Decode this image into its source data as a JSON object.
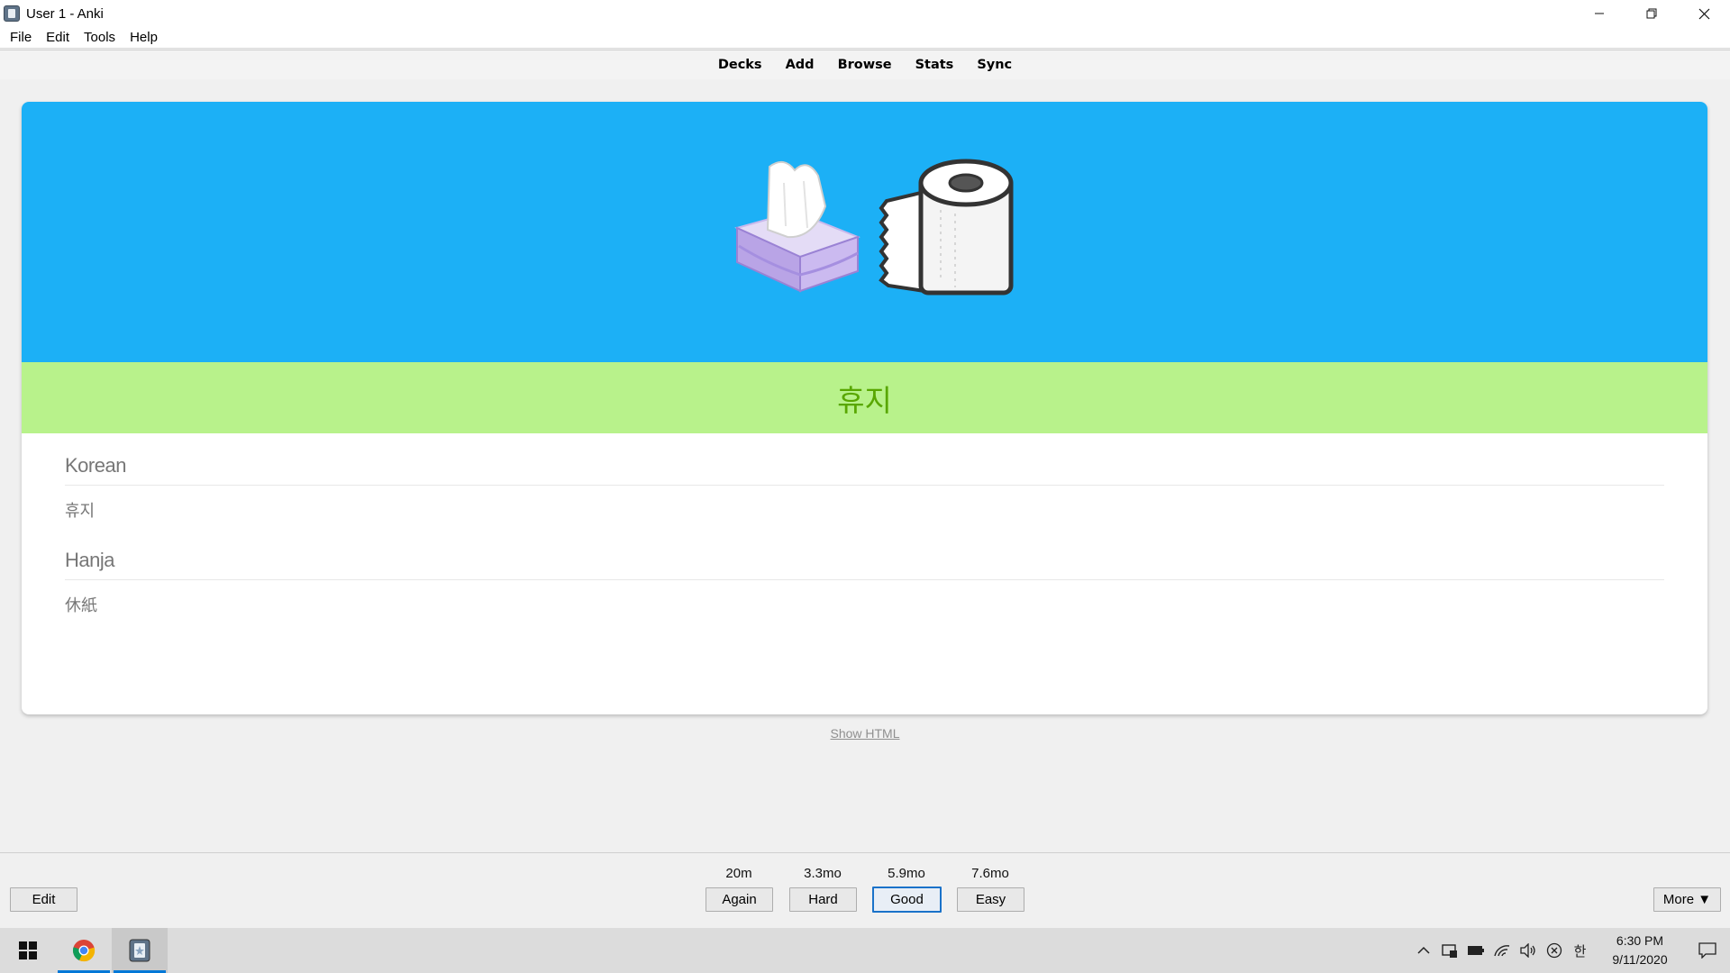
{
  "window": {
    "title": "User 1 - Anki",
    "app_icon": "anki-icon",
    "controls": {
      "minimize": "—",
      "restore": "❐",
      "close": "✕"
    }
  },
  "menu": [
    "File",
    "Edit",
    "Tools",
    "Help"
  ],
  "toolbar": [
    "Decks",
    "Add",
    "Browse",
    "Stats",
    "Sync"
  ],
  "card": {
    "image_band_color": "#1cb0f6",
    "word_band_color": "#b8f28b",
    "word_color": "#58a700",
    "illustration": [
      "tissue-box-icon",
      "toilet-paper-icon"
    ],
    "word": "휴지",
    "fields": [
      {
        "label": "Korean",
        "value": "휴지"
      },
      {
        "label": "Hanja",
        "value": "休紙"
      }
    ]
  },
  "show_html_link": "Show HTML",
  "answer_bar": {
    "edit_label": "Edit",
    "more_label": "More ▼",
    "ease_buttons": [
      {
        "time": "20m",
        "label": "Again"
      },
      {
        "time": "3.3mo",
        "label": "Hard"
      },
      {
        "time": "5.9mo",
        "label": "Good",
        "focused": true
      },
      {
        "time": "7.6mo",
        "label": "Easy"
      }
    ]
  },
  "taskbar": {
    "apps": [
      "start-icon",
      "chrome-icon",
      "anki-icon"
    ],
    "tray_icons": [
      "chevron-up-icon",
      "security-icon",
      "battery-icon",
      "wifi-icon",
      "volume-icon",
      "network-x-icon",
      "ime-icon"
    ],
    "ime_label": "한",
    "time": "6:30 PM",
    "date": "9/11/2020"
  }
}
